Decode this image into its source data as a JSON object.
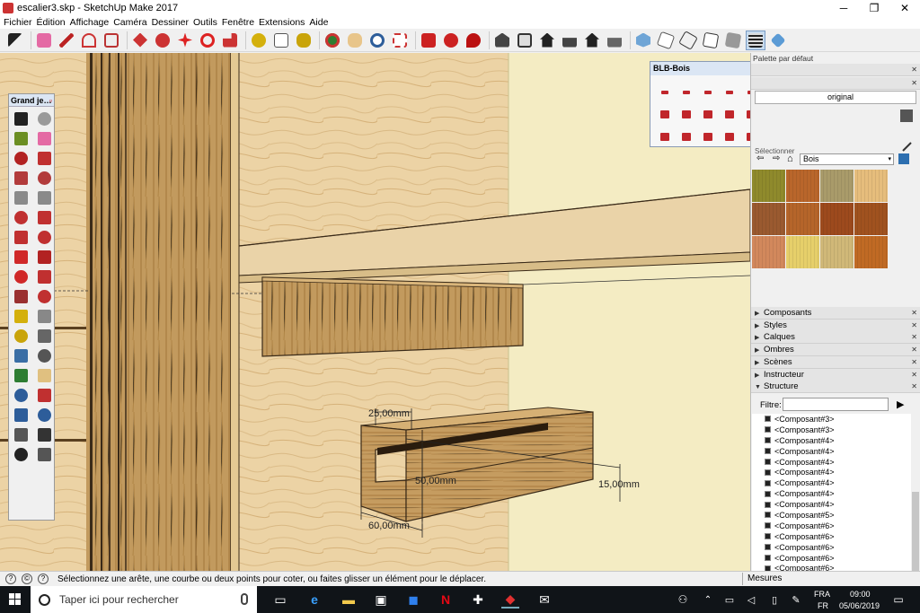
{
  "window": {
    "title": "escalier3.skp - SketchUp Make 2017",
    "controls": [
      "─",
      "❐",
      "✕"
    ]
  },
  "menu": [
    "Fichier",
    "Édition",
    "Affichage",
    "Caméra",
    "Dessiner",
    "Outils",
    "Fenêtre",
    "Extensions",
    "Aide"
  ],
  "tool_palette": {
    "title": "Grand je…",
    "tools": [
      {
        "icon": "select-icon",
        "color": "#222222"
      },
      {
        "icon": "component-icon",
        "color": "#9a9a9a"
      },
      {
        "icon": "paint-bucket-icon",
        "color": "#6b8e23"
      },
      {
        "icon": "eraser-icon",
        "color": "#e46aa4"
      },
      {
        "icon": "line-icon",
        "color": "#b22222"
      },
      {
        "icon": "freehand-icon",
        "color": "#c03030"
      },
      {
        "icon": "rectangle-icon",
        "color": "#b23b3b"
      },
      {
        "icon": "rotated-rectangle-icon",
        "color": "#b23b3b"
      },
      {
        "icon": "circle-icon",
        "color": "#8a8a8a"
      },
      {
        "icon": "polygon-icon",
        "color": "#8a8a8a"
      },
      {
        "icon": "arc-icon",
        "color": "#c03030"
      },
      {
        "icon": "arc-2pt-icon",
        "color": "#c03030"
      },
      {
        "icon": "arc-3pt-icon",
        "color": "#c03030"
      },
      {
        "icon": "pie-icon",
        "color": "#c03030"
      },
      {
        "icon": "move-icon",
        "color": "#d02828"
      },
      {
        "icon": "push-pull-icon",
        "color": "#b22222"
      },
      {
        "icon": "rotate-icon",
        "color": "#d02828"
      },
      {
        "icon": "follow-me-icon",
        "color": "#c03030"
      },
      {
        "icon": "scale-icon",
        "color": "#9a3030"
      },
      {
        "icon": "offset-icon",
        "color": "#c03030"
      },
      {
        "icon": "tape-measure-icon",
        "color": "#d4b00c"
      },
      {
        "icon": "dimension-icon",
        "color": "#888888"
      },
      {
        "icon": "protractor-icon",
        "color": "#c9a40a"
      },
      {
        "icon": "text-icon",
        "color": "#666666"
      },
      {
        "icon": "axes-icon",
        "color": "#3a6ea5"
      },
      {
        "icon": "3d-text-icon",
        "color": "#555555"
      },
      {
        "icon": "orbit-icon",
        "color": "#2e7d32"
      },
      {
        "icon": "pan-icon",
        "color": "#e0c080"
      },
      {
        "icon": "zoom-icon",
        "color": "#2d5d9a"
      },
      {
        "icon": "zoom-window-icon",
        "color": "#c03030"
      },
      {
        "icon": "zoom-extents-icon",
        "color": "#2d5d9a"
      },
      {
        "icon": "previous-view-icon",
        "color": "#2d5d9a"
      },
      {
        "icon": "position-camera-icon",
        "color": "#555555"
      },
      {
        "icon": "look-around-icon",
        "color": "#333333"
      },
      {
        "icon": "walk-icon",
        "color": "#222222"
      },
      {
        "icon": "section-plane-icon",
        "color": "#555555"
      }
    ]
  },
  "blb_palette": {
    "title": "BLB-Bois",
    "count": 21
  },
  "viewport": {
    "dimensions": [
      "25,00mm",
      "50,00mm",
      "15,00mm",
      "60,00mm"
    ]
  },
  "tray": {
    "title": "Palette par défaut",
    "material_label": "original",
    "selection_label": "Sélectionner",
    "library_name": "Bois",
    "swatches": [
      "#8f8a2c",
      "#b9662b",
      "#a99b6a",
      "#e6bd7c",
      "#9a5a30",
      "#b5652a",
      "#9d4a1d",
      "#a0521f",
      "#d2885c",
      "#e6cf6a",
      "#d0b878",
      "#c06a24"
    ],
    "panels": [
      {
        "label": "Composants",
        "expanded": false
      },
      {
        "label": "Styles",
        "expanded": false
      },
      {
        "label": "Calques",
        "expanded": false
      },
      {
        "label": "Ombres",
        "expanded": false
      },
      {
        "label": "Scènes",
        "expanded": false
      },
      {
        "label": "Instructeur",
        "expanded": false
      },
      {
        "label": "Structure",
        "expanded": true
      }
    ],
    "filter_label": "Filtre:",
    "outliner_items": [
      "<Composant#3>",
      "<Composant#3>",
      "<Composant#4>",
      "<Composant#4>",
      "<Composant#4>",
      "<Composant#4>",
      "<Composant#4>",
      "<Composant#4>",
      "<Composant#4>",
      "<Composant#5>",
      "<Composant#6>",
      "<Composant#6>",
      "<Composant#6>",
      "<Composant#6>",
      "<Composant#6>"
    ]
  },
  "status": {
    "message": "Sélectionnez une arête, une courbe ou deux points pour coter, ou faites glisser un élément pour le déplacer.",
    "measures_label": "Mesures"
  },
  "taskbar": {
    "search_placeholder": "Taper ici pour rechercher",
    "language_top": "FRA",
    "language_bottom": "FR",
    "time": "09:00",
    "date": "05/06/2019"
  },
  "colors": {
    "wood_light": "#e9cf9f",
    "wood_dark": "#b48a4e",
    "wall_yellow": "#f4ecc3",
    "taskbar": "#101418"
  }
}
